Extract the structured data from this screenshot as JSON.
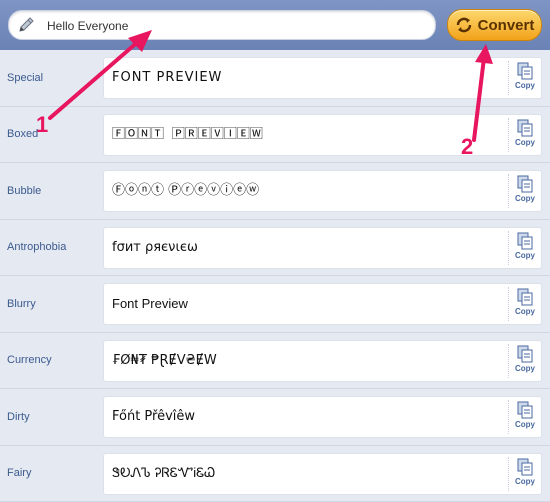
{
  "search": {
    "value": "Hello Everyone",
    "placeholder": ""
  },
  "convert_label": "Convert",
  "copy_label": "Copy",
  "rows": [
    {
      "name": "Special",
      "preview": "FONT PREVIEW"
    },
    {
      "name": "Boxed",
      "preview": "🄵🄾🄽🅃 🄿🅁🄴🅅🄸🄴🅆"
    },
    {
      "name": "Bubble",
      "preview": "Ⓕⓞⓝⓣ Ⓟⓡⓔⓥⓘⓔⓦ"
    },
    {
      "name": "Antrophobia",
      "preview": "fσит ρяєνιєω"
    },
    {
      "name": "Blurry",
      "preview": "Font Preview"
    },
    {
      "name": "Currency",
      "preview": "₣Ø₦₮ ₱ⱤɆV₴ɆW"
    },
    {
      "name": "Dirty",
      "preview": "Főńt Přêvîêw"
    },
    {
      "name": "Fairy",
      "preview": "ᏕᎧᏁᏖ ᎮᏒᏋᏉᎥᏋᏇ"
    }
  ],
  "annotations": {
    "first": "1",
    "second": "2"
  },
  "colors": {
    "accent": "#e8155f",
    "topbar": "#7089bb",
    "button": "#f5b133"
  }
}
